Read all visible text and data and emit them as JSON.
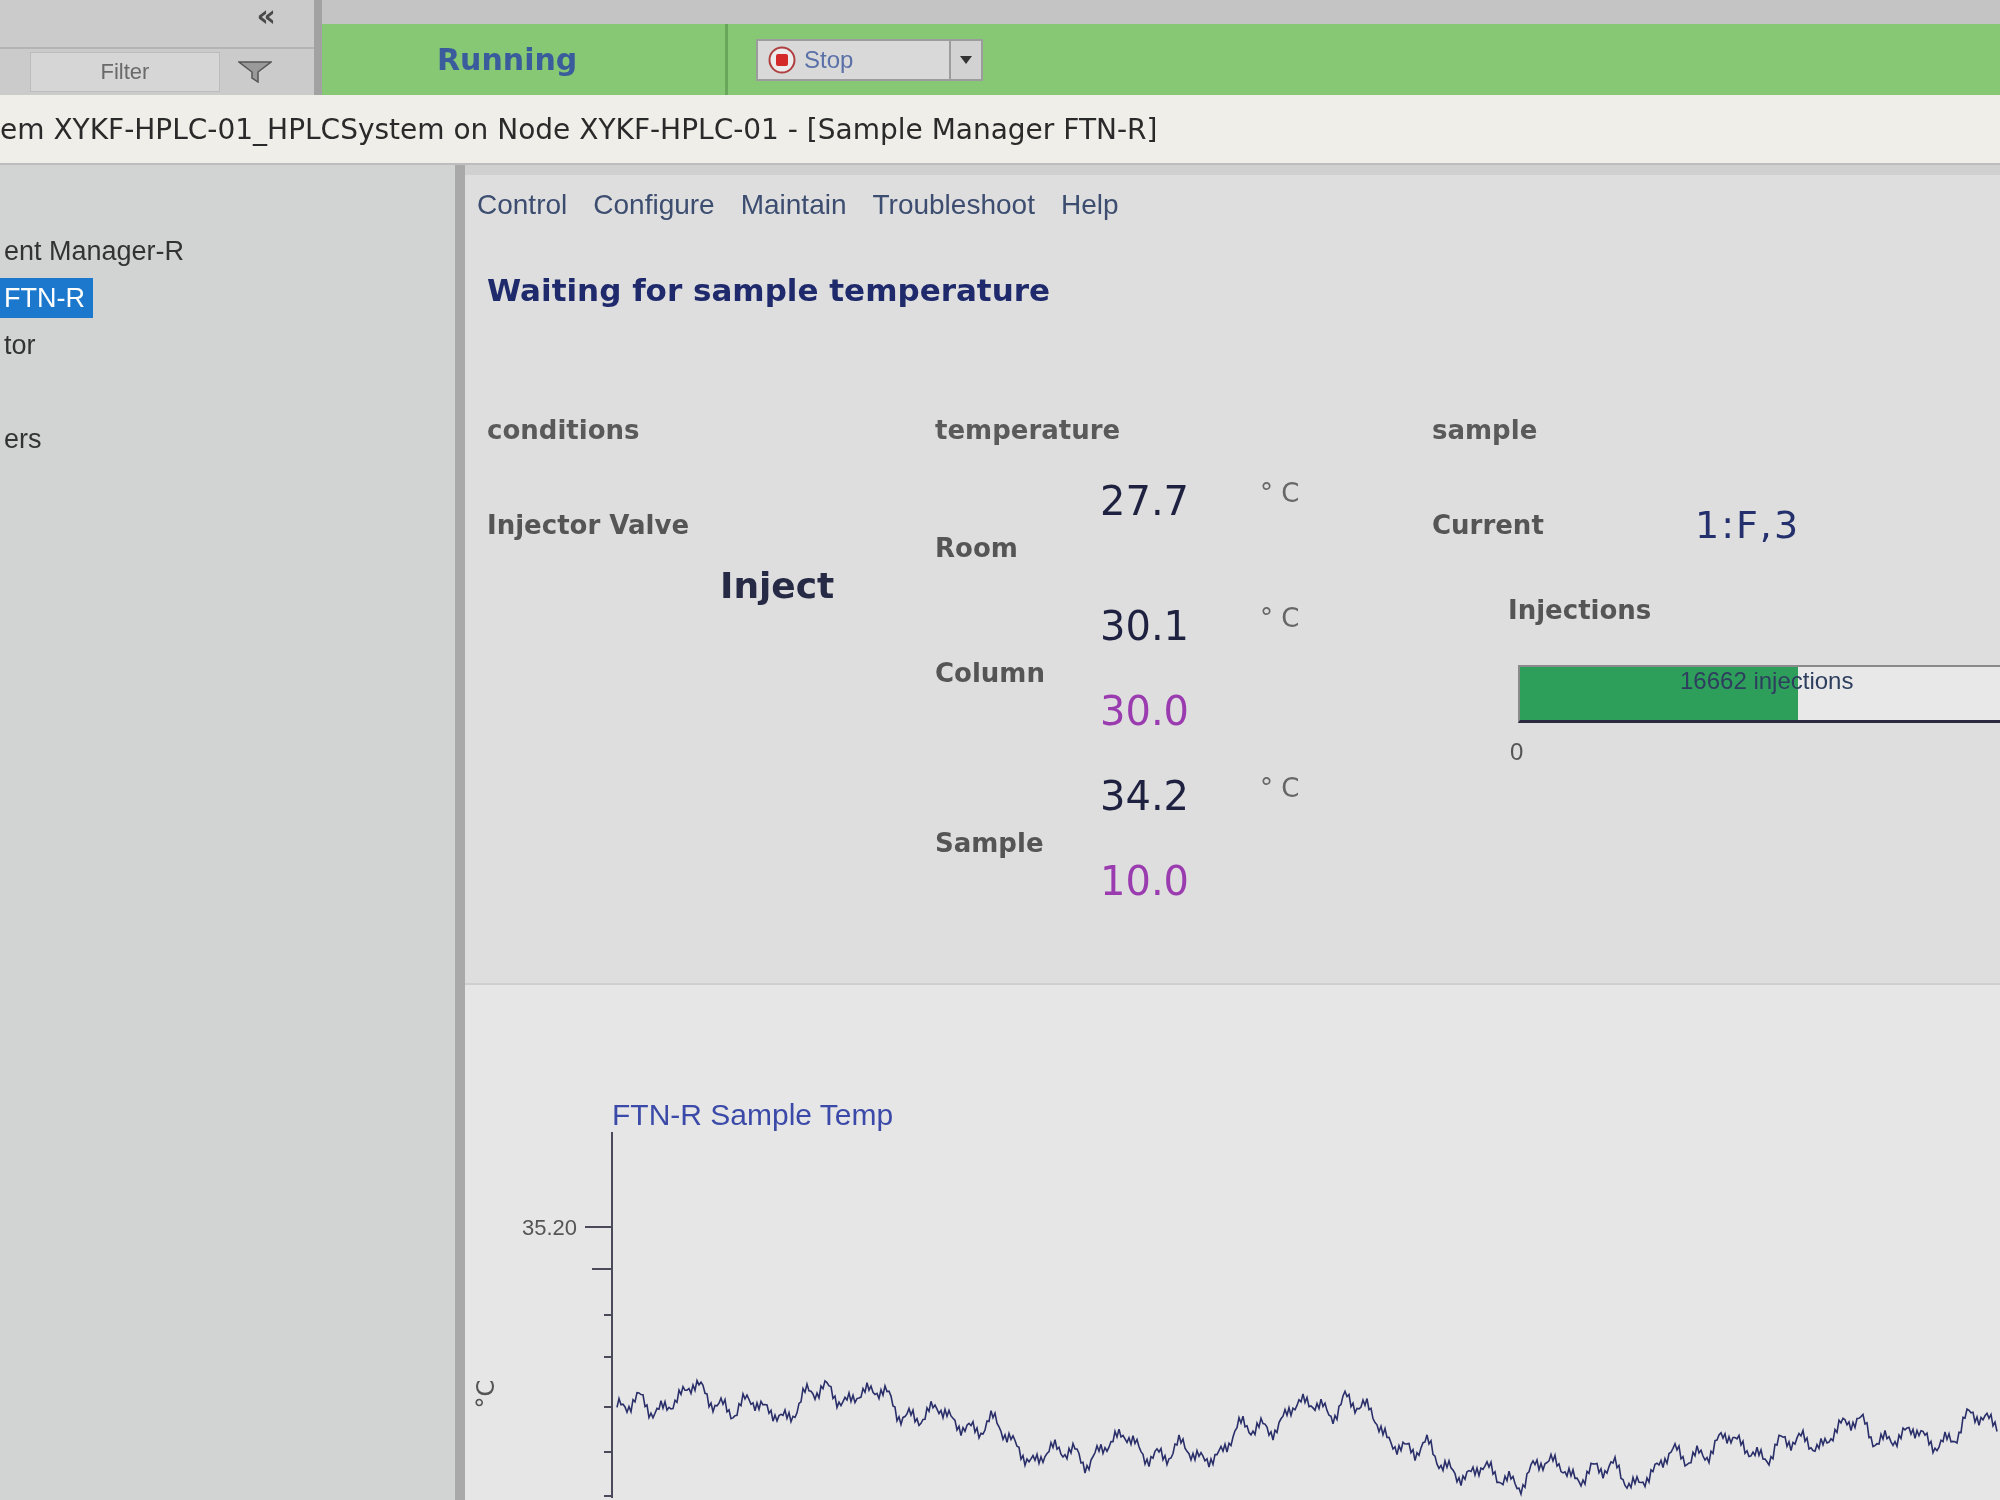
{
  "top_bar": {
    "collapse_glyph": "«",
    "filter": {
      "placeholder": "Filter"
    },
    "status": "Running",
    "stop_button": {
      "label": "Stop"
    }
  },
  "window": {
    "title": "em XYKF-HPLC-01_HPLCSystem on Node XYKF-HPLC-01 - [Sample Manager FTN-R]"
  },
  "sidebar": {
    "items": [
      {
        "label": "ent Manager-R",
        "selected": false
      },
      {
        "label": "FTN-R",
        "selected": true
      },
      {
        "label": "tor",
        "selected": false
      },
      {
        "label": "ers",
        "selected": false
      }
    ]
  },
  "menu": [
    "Control",
    "Configure",
    "Maintain",
    "Troubleshoot",
    "Help"
  ],
  "status_message": "Waiting for sample temperature",
  "conditions": {
    "heading": "conditions",
    "injector_valve": {
      "label": "Injector Valve",
      "value": "Inject"
    }
  },
  "temperature": {
    "heading": "temperature",
    "rows": [
      {
        "label": "Room",
        "reading": "27.7",
        "unit": "° C"
      },
      {
        "label": "Column",
        "reading": "30.1",
        "unit": "° C",
        "setpoint": "30.0"
      },
      {
        "label": "Sample",
        "reading": "34.2",
        "unit": "° C",
        "setpoint": "10.0"
      }
    ]
  },
  "sample": {
    "heading": "sample",
    "current": {
      "label": "Current",
      "value": "1:F,3"
    },
    "injections": {
      "label": "Injections",
      "level": 0.58,
      "bar_text": "16662 injections",
      "scale_min": "0"
    }
  },
  "trend_chart": {
    "title": "FTN-R Sample Temp",
    "ytick_label": "35.20",
    "ylabel": "°C"
  }
}
